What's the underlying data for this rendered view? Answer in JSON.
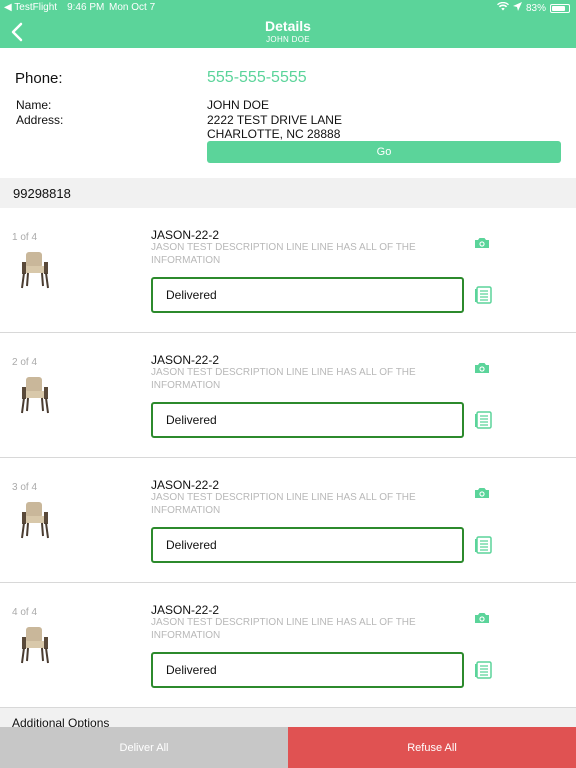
{
  "status_bar": {
    "app": "◀ TestFlight",
    "time": "9:46 PM",
    "date": "Mon Oct 7",
    "battery": "83%",
    "battery_level": 0.83
  },
  "navbar": {
    "title": "Details",
    "subtitle": "JOHN DOE"
  },
  "customer": {
    "phone_label": "Phone:",
    "phone": "555-555-5555",
    "name_label": "Name:",
    "name": "JOHN DOE",
    "address_label": "Address:",
    "address_line1": "2222 TEST DRIVE LANE",
    "address_line2": "CHARLOTTE, NC 28888",
    "go_label": "Go"
  },
  "order": {
    "number": "99298818"
  },
  "items": [
    {
      "counter": "1 of 4",
      "name": "JASON-22-2",
      "description": "JASON TEST DESCRIPTION LINE LINE HAS ALL OF THE INFORMATION",
      "status": "Delivered"
    },
    {
      "counter": "2 of 4",
      "name": "JASON-22-2",
      "description": "JASON TEST DESCRIPTION LINE LINE HAS ALL OF THE INFORMATION",
      "status": "Delivered"
    },
    {
      "counter": "3 of 4",
      "name": "JASON-22-2",
      "description": "JASON TEST DESCRIPTION LINE LINE HAS ALL OF THE INFORMATION",
      "status": "Delivered"
    },
    {
      "counter": "4 of 4",
      "name": "JASON-22-2",
      "description": "JASON TEST DESCRIPTION LINE LINE HAS ALL OF THE INFORMATION",
      "status": "Delivered"
    }
  ],
  "additional_options_label": "Additional Options",
  "footer": {
    "deliver_all": "Deliver All",
    "refuse_all": "Refuse All"
  },
  "icons": {
    "back": "chevron-left-icon",
    "item_image": "chair-icon",
    "camera": "camera-icon",
    "notes": "list-icon",
    "wifi": "wifi-icon",
    "location": "location-arrow-icon"
  },
  "colors": {
    "accent": "#5bd49a",
    "status_border": "#2c8a2c",
    "refuse": "#e05252",
    "deliver_disabled": "#c7c7c7"
  }
}
